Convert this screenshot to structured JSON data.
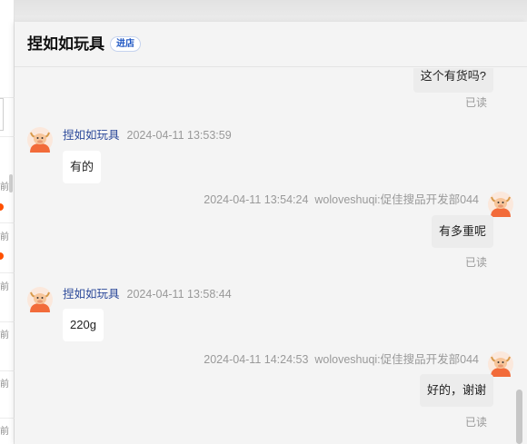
{
  "header": {
    "shop_name": "捏如如玩具",
    "store_button": "进店"
  },
  "conversation_list": {
    "partial_labels": [
      "前",
      "前",
      "前",
      "前",
      "前",
      "前"
    ]
  },
  "messages": [
    {
      "id": "m0",
      "side": "right",
      "text": "这个有货吗?",
      "read": "已读"
    },
    {
      "id": "m1",
      "side": "left",
      "sender": "捏如如玩具",
      "time": "2024-04-11 13:53:59",
      "text": "有的"
    },
    {
      "id": "m2",
      "side": "right",
      "time": "2024-04-11 13:54:24",
      "sender": "woloveshuqi:促佳搜品开发部044",
      "text": "有多重呢",
      "read": "已读"
    },
    {
      "id": "m3",
      "side": "left",
      "sender": "捏如如玩具",
      "time": "2024-04-11 13:58:44",
      "text": "220g"
    },
    {
      "id": "m4",
      "side": "right",
      "time": "2024-04-11 14:24:53",
      "sender": "woloveshuqi:促佳搜品开发部044",
      "text": "好的，谢谢",
      "read": "已读"
    }
  ],
  "colors": {
    "accent_blue": "#1f57c3",
    "name_blue": "#2d4a9a",
    "badge_orange": "#ff5000",
    "avatar_orange": "#f26b3a"
  },
  "icons": {
    "shop_avatar": "cartoon-bull-avatar-icon",
    "user_avatar": "cartoon-bull-avatar-icon"
  }
}
